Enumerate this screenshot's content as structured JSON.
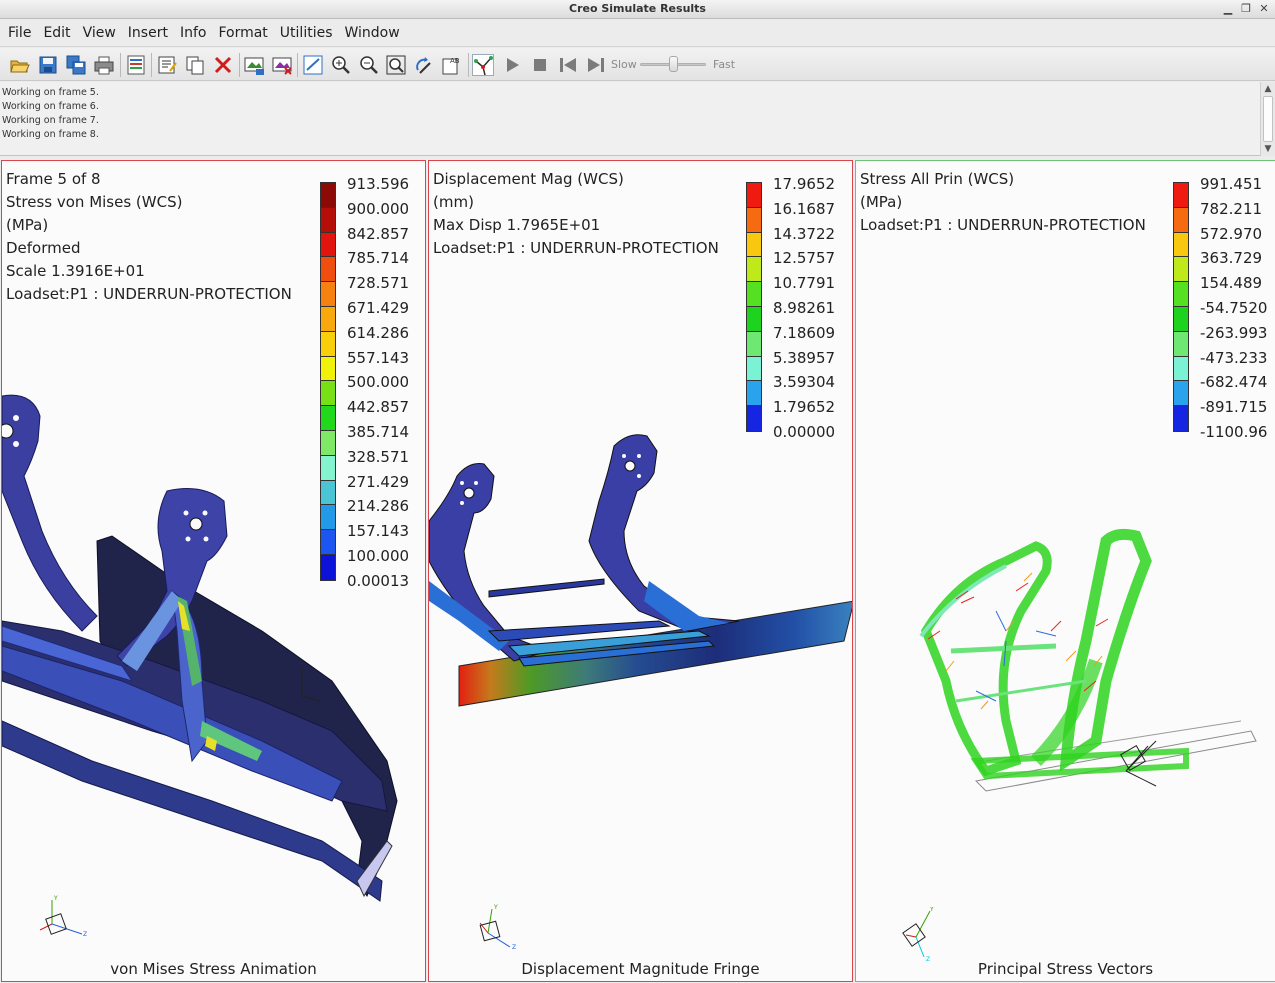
{
  "window": {
    "title": "Creo Simulate Results"
  },
  "menu": [
    "File",
    "Edit",
    "View",
    "Insert",
    "Info",
    "Format",
    "Utilities",
    "Window"
  ],
  "toolbar": {
    "icons": [
      "open-icon",
      "save-icon",
      "save-copy-icon",
      "print-icon",
      "report-icon",
      "edit-definition-icon",
      "copy-icon",
      "delete-icon",
      "show-icon",
      "hide-icon",
      "grid-toggle-icon",
      "zoom-in-icon",
      "zoom-out-icon",
      "refit-icon",
      "spin-icon",
      "annotate-icon",
      "animate-icon",
      "play-icon",
      "stop-icon",
      "first-frame-icon",
      "next-frame-icon"
    ],
    "speed_slow": "Slow",
    "speed_fast": "Fast"
  },
  "messages": [
    "Working on frame 5.",
    "Working on frame 6.",
    "Working on frame 7.",
    "Working on frame 8."
  ],
  "viewports": [
    {
      "info": [
        "Frame 5 of 8",
        "Stress von Mises (WCS)",
        "(MPa)",
        "Deformed",
        "Scale  1.3916E+01",
        "Loadset:P1 :  UNDERRUN-PROTECTION"
      ],
      "legend": [
        "913.596",
        "900.000",
        "842.857",
        "785.714",
        "728.571",
        "671.429",
        "614.286",
        "557.143",
        "500.000",
        "442.857",
        "385.714",
        "328.571",
        "271.429",
        "214.286",
        "157.143",
        "100.000",
        "0.00013"
      ],
      "legend_colors": [
        "#8b0a06",
        "#b50d08",
        "#e1150d",
        "#f04e0f",
        "#f68111",
        "#f9a80d",
        "#f9cf0c",
        "#f0f20a",
        "#79e015",
        "#22d81a",
        "#7fe866",
        "#86f3cf",
        "#4bc5d3",
        "#229ae8",
        "#1d55f0",
        "#0b13d8",
        "#1b1f75"
      ],
      "caption": "von Mises Stress Animation"
    },
    {
      "info": [
        "Displacement Mag (WCS)",
        "(mm)",
        "Max Disp  1.7965E+01",
        "Loadset:P1 :  UNDERRUN-PROTECTION"
      ],
      "legend": [
        "17.9652",
        "16.1687",
        "14.3722",
        "12.5757",
        "10.7791",
        "8.98261",
        "7.18609",
        "5.38957",
        "3.59304",
        "1.79652",
        "0.00000"
      ],
      "legend_colors": [
        "#f01b10",
        "#f66a12",
        "#f7c80d",
        "#bfe91a",
        "#55e021",
        "#1ed31e",
        "#6ee872",
        "#7cf2d5",
        "#2aa3ee",
        "#1525e2",
        "#1b1f75"
      ],
      "caption": "Displacement Magnitude Fringe"
    },
    {
      "info": [
        "Stress All Prin (WCS)",
        "(MPa)",
        "Loadset:P1 :  UNDERRUN-PROTECTION"
      ],
      "legend": [
        "991.451",
        "782.211",
        "572.970",
        "363.729",
        "154.489",
        "-54.7520",
        "-263.993",
        "-473.233",
        "-682.474",
        "-891.715",
        "-1100.96"
      ],
      "legend_colors": [
        "#f01b10",
        "#f66a12",
        "#f7c80d",
        "#bfe91a",
        "#55e021",
        "#1ed31e",
        "#6ee872",
        "#7cf2d5",
        "#2aa3ee",
        "#1525e2",
        "#1b1f75"
      ],
      "caption": "Principal Stress Vectors"
    }
  ]
}
